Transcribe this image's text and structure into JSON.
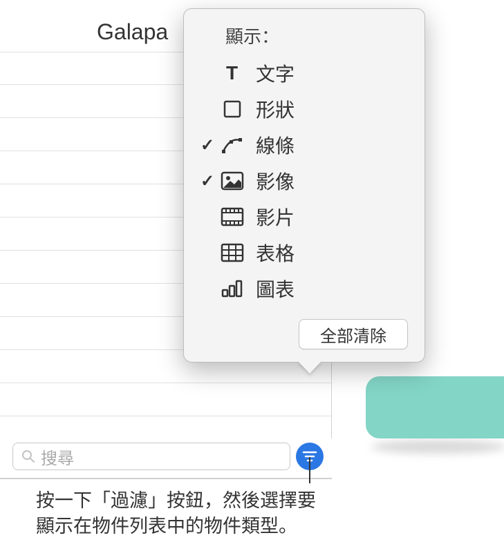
{
  "title": "Galapa",
  "search": {
    "placeholder": "搜尋"
  },
  "popover": {
    "header": "顯示：",
    "items": [
      {
        "label": "文字",
        "checked": false,
        "icon": "text"
      },
      {
        "label": "形狀",
        "checked": false,
        "icon": "shape"
      },
      {
        "label": "線條",
        "checked": true,
        "icon": "line"
      },
      {
        "label": "影像",
        "checked": true,
        "icon": "image"
      },
      {
        "label": "影片",
        "checked": false,
        "icon": "movie"
      },
      {
        "label": "表格",
        "checked": false,
        "icon": "table"
      },
      {
        "label": "圖表",
        "checked": false,
        "icon": "chart"
      }
    ],
    "clear_label": "全部清除"
  },
  "callout": {
    "line1": "按一下「過濾」按鈕，然後選擇要",
    "line2": "顯示在物件列表中的物件類型。"
  }
}
